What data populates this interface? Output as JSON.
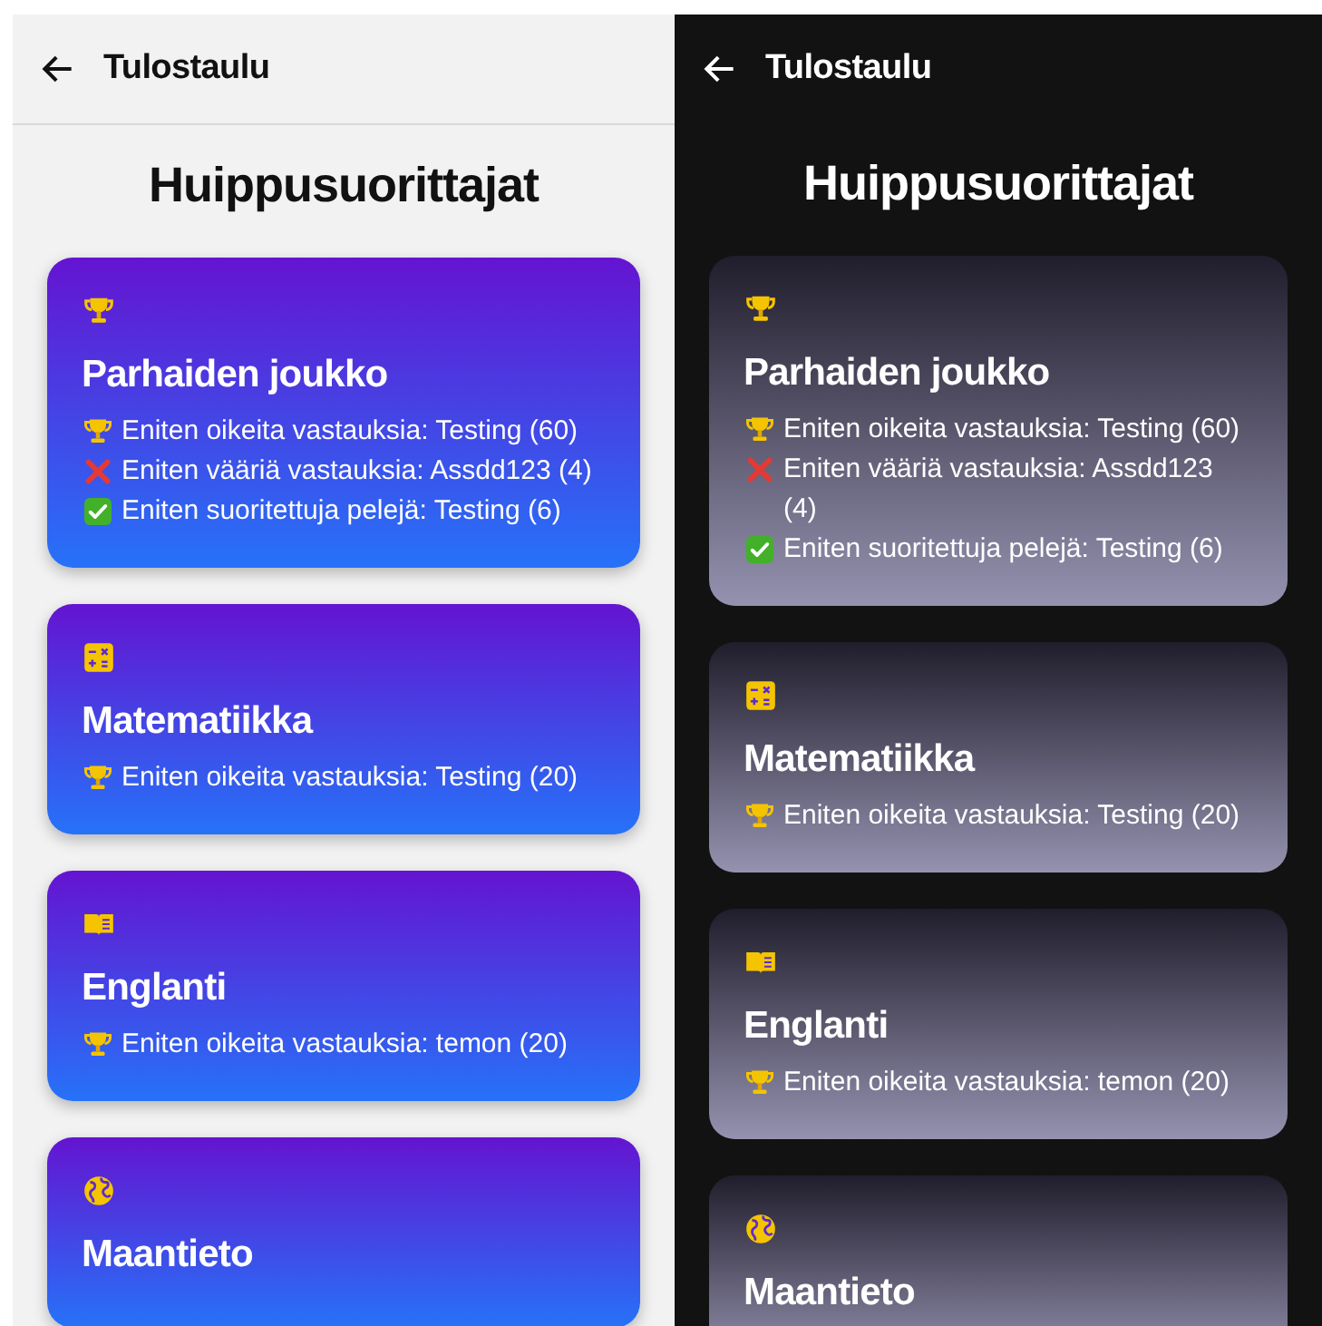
{
  "screens": [
    {
      "kind": "light",
      "header": {
        "title": "Tulostaulu"
      },
      "heading": "Huippusuorittajat",
      "cards": [
        {
          "kind": "trophy",
          "title": "Parhaiden joukko",
          "stats": [
            {
              "kind": "trophy",
              "text": "Eniten oikeita vastauksia: Testing (60)"
            },
            {
              "kind": "cross",
              "text": "Eniten vääriä vastauksia: Assdd123 (4)"
            },
            {
              "kind": "check",
              "text": "Eniten suoritettuja pelejä: Testing (6)"
            }
          ]
        },
        {
          "kind": "calculator",
          "title": "Matematiikka",
          "stats": [
            {
              "kind": "trophy",
              "text": "Eniten oikeita vastauksia: Testing (20)"
            }
          ]
        },
        {
          "kind": "book",
          "title": "Englanti",
          "stats": [
            {
              "kind": "trophy",
              "text": "Eniten oikeita vastauksia: temon (20)"
            }
          ]
        },
        {
          "kind": "globe",
          "title": "Maantieto"
        }
      ]
    },
    {
      "kind": "dark",
      "header": {
        "title": "Tulostaulu"
      },
      "heading": "Huippusuorittajat",
      "cards": [
        {
          "kind": "trophy",
          "title": "Parhaiden joukko",
          "stats": [
            {
              "kind": "trophy",
              "text": "Eniten oikeita vastauksia: Testing (60)"
            },
            {
              "kind": "cross",
              "text": "Eniten vääriä vastauksia: Assdd123 (4)"
            },
            {
              "kind": "check",
              "text": "Eniten suoritettuja pelejä: Testing (6)"
            }
          ]
        },
        {
          "kind": "calculator",
          "title": "Matematiikka",
          "stats": [
            {
              "kind": "trophy",
              "text": "Eniten oikeita vastauksia: Testing (20)"
            }
          ]
        },
        {
          "kind": "book",
          "title": "Englanti",
          "stats": [
            {
              "kind": "trophy",
              "text": "Eniten oikeita vastauksia: temon (20)"
            }
          ]
        },
        {
          "kind": "globe",
          "title": "Maantieto"
        }
      ]
    }
  ]
}
